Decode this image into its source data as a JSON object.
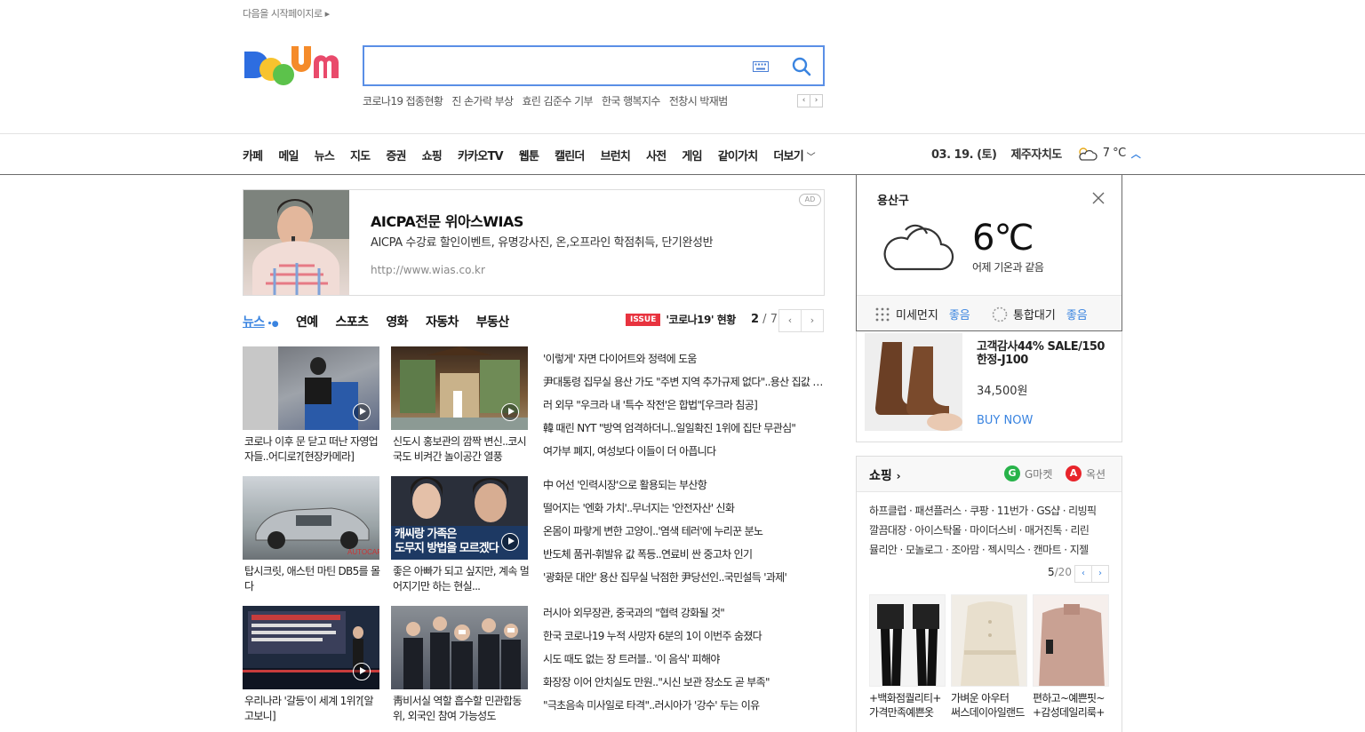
{
  "top_link": "다음을 시작페이지로",
  "search": {
    "value": "",
    "placeholder": ""
  },
  "trends": [
    "코로나19 접종현황",
    "진 손가락 부상",
    "효린 김준수 기부",
    "한국 행복지수",
    "전창시 박재범"
  ],
  "gnb": {
    "items": [
      "카페",
      "메일",
      "뉴스",
      "지도",
      "증권",
      "쇼핑",
      "카카오TV",
      "웹툰",
      "캘린더",
      "브런치",
      "사전",
      "게임",
      "같이가치",
      "더보기"
    ],
    "date": "03. 19. (토)",
    "region": "제주자치도",
    "temp": "7 °C"
  },
  "ad": {
    "title": "AICPA전문 위아스WIAS",
    "desc": "AICPA 수강료 할인이벤트, 유명강사진, 온,오프라인 학점취득, 단기완성반",
    "url": "http://www.wias.co.kr",
    "badge": "AD"
  },
  "news_tabs": [
    "뉴스",
    "연예",
    "스포츠",
    "영화",
    "자동차",
    "부동산"
  ],
  "issue": {
    "badge": "ISSUE",
    "text": "'코로나19' 현황"
  },
  "pager": {
    "current": "2",
    "total": " / 7"
  },
  "thumbs": [
    {
      "caption": "코로나 이후 문 닫고 떠난 자영업자들..어디로?[현장카메라]"
    },
    {
      "caption": "신도시 홍보관의 깜짝 변신..코시국도 비켜간 놀이공간 열풍"
    },
    {
      "caption": "탑시크릿, 애스턴 마틴 DB5를 몰다"
    },
    {
      "caption": "좋은 아빠가 되고 싶지만, 계속 멀어지기만 하는 현실..."
    },
    {
      "caption": "우리나라 '갈등'이 세계 1위?[알고보니]"
    },
    {
      "caption": "靑비서실 역할 흡수할 민관합동위, 외국인 참여 가능성도"
    }
  ],
  "headlines": [
    [
      "'이렇게' 자면 다이어트와 정력에 도움",
      "尹대통령 집무실 용산 가도 \"주변 지역 추가규제 없다\"..용산 집값 들썩",
      "러 외무 \"우크라 내 '특수 작전'은 합법\"[우크라 침공]",
      "韓 때린 NYT \"방역 엄격하더니..일일확진 1위에 집단 무관심\"",
      "여가부 폐지, 여성보다 이들이 더 아픕니다"
    ],
    [
      "中 어선 '인력시장'으로 활용되는 부산항",
      "떨어지는 '엔화 가치'..무너지는 '안전자산' 신화",
      "온몸이 파랗게 변한 고양이..'염색 테러'에 누리꾼 분노",
      "반도체 품귀-휘발유 값 폭등..연료비 싼 중고차 인기",
      "'광화문 대안' 용산 집무실 낙점한 尹당선인..국민설득 '과제'"
    ],
    [
      "러시아 외무장관, 중국과의 \"협력 강화될 것\"",
      "한국 코로나19 누적 사망자 6분의 1이 이번주 숨졌다",
      "시도 때도 없는 장 트러블.. '이 음식' 피해야",
      "화장장 이어 안치실도 만원..\"시신 보관 장소도 곧 부족\"",
      "\"극초음속 미사일로 타격\"..러시아가 '강수' 두는 이유"
    ]
  ],
  "weather": {
    "location": "용산구",
    "temp": "6℃",
    "desc": "어제 기온과 같음",
    "dust_label": "미세먼지",
    "dust_value": "좋음",
    "air_label": "통합대기",
    "air_value": "좋음"
  },
  "product": {
    "title": "고객감사44% SALE/150한정-J100",
    "price": "34,500원",
    "buy": "BUY NOW"
  },
  "shopping": {
    "title": "쇼핑",
    "gmarket": "G마켓",
    "auction": "옥션",
    "links": [
      "하프클럽 · 패션플러스 · 쿠팡 · 11번가 · GS샵 · 리빙픽",
      "깔끔대장 · 아이스탁몰 · 마이더스비 · 매거진톡 · 리린",
      "뮬리안 · 모놀로그 · 조아맘 · 젝시믹스 · 캔마트 · 지젤"
    ],
    "pager_current": "5",
    "pager_total": "/20",
    "items": [
      {
        "name_line1": "+백화점퀄리티+",
        "name_line2": "가격만족예쁜옷"
      },
      {
        "name_line1": "가벼운 아우터",
        "name_line2": "써스데이아일랜드"
      },
      {
        "name_line1": "편하고~예쁜핏~",
        "name_line2": "+감성데일리룩+"
      }
    ]
  },
  "colors": {
    "accent": "#3a84e0",
    "search_border": "#5a8fe6",
    "issue": "#e8333f"
  }
}
